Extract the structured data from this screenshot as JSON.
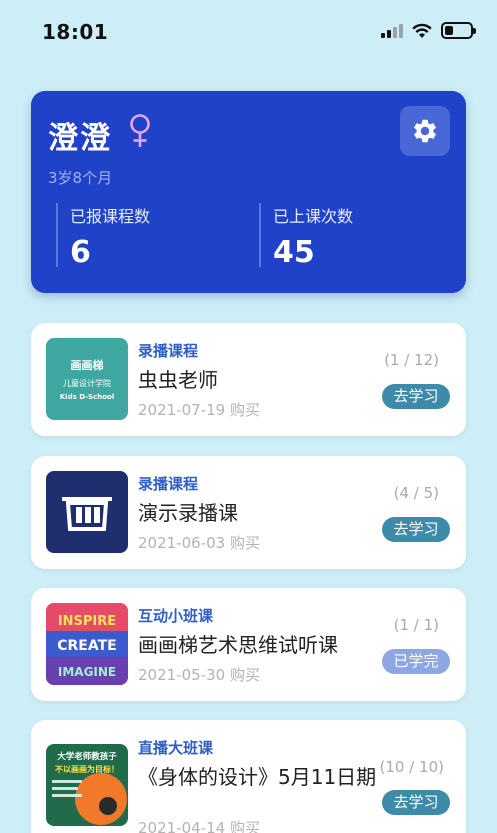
{
  "status_bar": {
    "time": "18:01",
    "battery_level": 0.35
  },
  "profile": {
    "name": "澄澄",
    "gender_icon": "female-icon",
    "age": "3岁8个月",
    "stats": [
      {
        "label": "已报课程数",
        "value": "6"
      },
      {
        "label": "已上课次数",
        "value": "45"
      }
    ]
  },
  "courses": [
    {
      "type": "录播课程",
      "title": "虫虫老师",
      "date": "2021-07-19 购买",
      "progress": "(1 / 12)",
      "action": "去学习",
      "thumb": {
        "brand": "画画梯",
        "line1": "儿童设计学院",
        "line2": "Kids D-School"
      }
    },
    {
      "type": "录播课程",
      "title": "演示录播课",
      "date": "2021-06-03 购买",
      "progress": "(4 / 5)",
      "action": "去学习"
    },
    {
      "type": "互动小班课",
      "title": "画画梯艺术思维试听课",
      "date": "2021-05-30 购买",
      "progress": "(1 / 1)",
      "action": "已学完",
      "thumb": {
        "line1": "INSPIRE",
        "line2": "CREATE",
        "line3": "IMAGINE"
      }
    },
    {
      "type": "直播大班课",
      "title": "《身体的设计》5月11日期",
      "date": "2021-04-14 购买",
      "progress": "(10 / 10)",
      "action": "去学习",
      "thumb": {
        "line1": "大学老师教孩子",
        "line2": "不以画画为目标！"
      }
    }
  ],
  "colors": {
    "background": "#cdeef6",
    "card": "#2042c9",
    "accent": "#3d8ba8"
  }
}
